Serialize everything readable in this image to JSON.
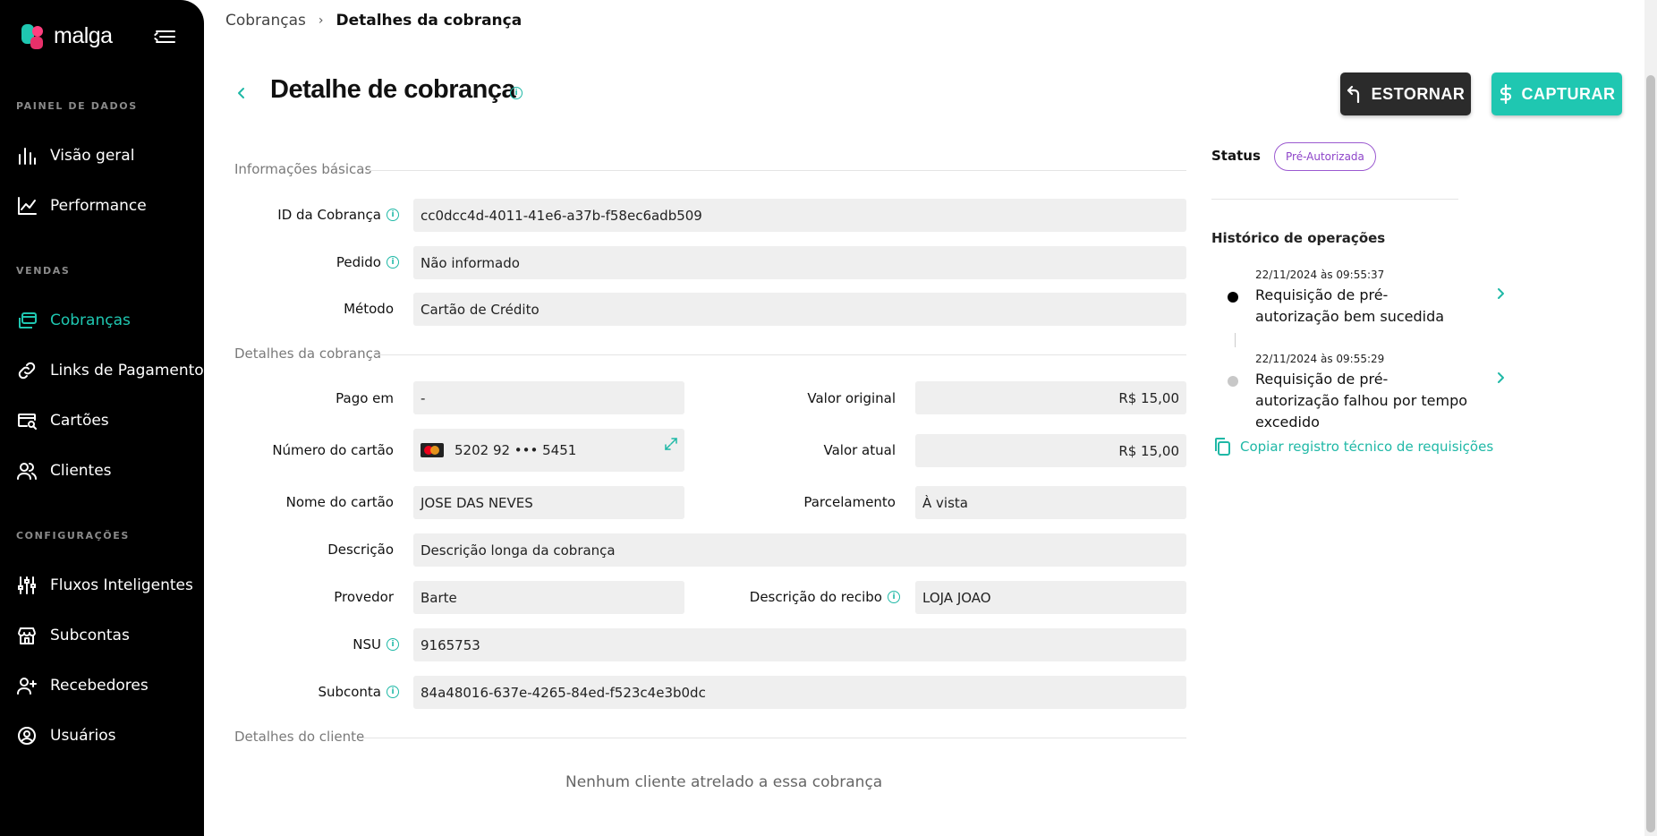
{
  "brand": {
    "name": "malga"
  },
  "sidebar": {
    "sections": [
      {
        "label": "PAINEL DE DADOS"
      },
      {
        "label": "VENDAS"
      },
      {
        "label": "CONFIGURAÇÕES"
      }
    ],
    "items": [
      {
        "label": "Visão geral",
        "icon": "bar-chart-icon",
        "active": false
      },
      {
        "label": "Performance",
        "icon": "line-chart-icon",
        "active": false
      },
      {
        "label": "Cobranças",
        "icon": "charges-icon",
        "active": true
      },
      {
        "label": "Links de Pagamento",
        "icon": "link-icon",
        "active": false
      },
      {
        "label": "Cartões",
        "icon": "card-search-icon",
        "active": false
      },
      {
        "label": "Clientes",
        "icon": "users-icon",
        "active": false
      },
      {
        "label": "Fluxos Inteligentes",
        "icon": "sliders-icon",
        "active": false
      },
      {
        "label": "Subcontas",
        "icon": "store-icon",
        "active": false
      },
      {
        "label": "Recebedores",
        "icon": "user-plus-icon",
        "active": false
      },
      {
        "label": "Usuários",
        "icon": "user-circle-icon",
        "active": false
      }
    ]
  },
  "breadcrumb": {
    "parent": "Cobranças",
    "separator": "›",
    "current": "Detalhes da cobrança"
  },
  "header": {
    "title": "Detalhe de cobrança",
    "refund_label": "ESTORNAR",
    "capture_label": "CAPTURAR"
  },
  "groups": {
    "basic": "Informações básicas",
    "charge": "Detalhes da cobrança",
    "customer": "Detalhes do cliente"
  },
  "fields": {
    "charge_id": {
      "label": "ID da Cobrança",
      "value": "cc0dcc4d-4011-41e6-a37b-f58ec6adb509"
    },
    "order": {
      "label": "Pedido",
      "value": "Não informado"
    },
    "method": {
      "label": "Método",
      "value": "Cartão de Crédito"
    },
    "paid_at": {
      "label": "Pago em",
      "value": "-"
    },
    "original_value": {
      "label": "Valor original",
      "value": "R$ 15,00"
    },
    "card_number": {
      "label": "Número do cartão",
      "value": "5202 92 ••• 5451"
    },
    "current_value": {
      "label": "Valor atual",
      "value": "R$ 15,00"
    },
    "card_name": {
      "label": "Nome do cartão",
      "value": "JOSE DAS NEVES"
    },
    "installments": {
      "label": "Parcelamento",
      "value": "À vista"
    },
    "description": {
      "label": "Descrição",
      "value": "Descrição longa da cobrança"
    },
    "provider": {
      "label": "Provedor",
      "value": "Barte"
    },
    "receipt_description": {
      "label": "Descrição do recibo",
      "value": "LOJA JOAO"
    },
    "nsu": {
      "label": "NSU",
      "value": "9165753"
    },
    "subaccount": {
      "label": "Subconta",
      "value": "84a48016-637e-4265-84ed-f523c4e3b0dc"
    }
  },
  "customer": {
    "empty_message": "Nenhum cliente atrelado a essa cobrança"
  },
  "status": {
    "label": "Status",
    "value": "Pré-Autorizada",
    "color": "#8e44c9"
  },
  "history": {
    "title": "Histórico de operações",
    "items": [
      {
        "time": "22/11/2024 às 09:55:37",
        "text": "Requisição de pré-autorização bem sucedida",
        "dot_color": "#000000"
      },
      {
        "time": "22/11/2024 às 09:55:29",
        "text": "Requisição de pré-autorização falhou por tempo excedido",
        "dot_color": "#c8c8c8"
      }
    ],
    "copy_label": "Copiar registro técnico de requisições"
  },
  "colors": {
    "accent": "#1fc7b1",
    "dark_button": "#2b2b2b",
    "sidebar": "#000000"
  }
}
